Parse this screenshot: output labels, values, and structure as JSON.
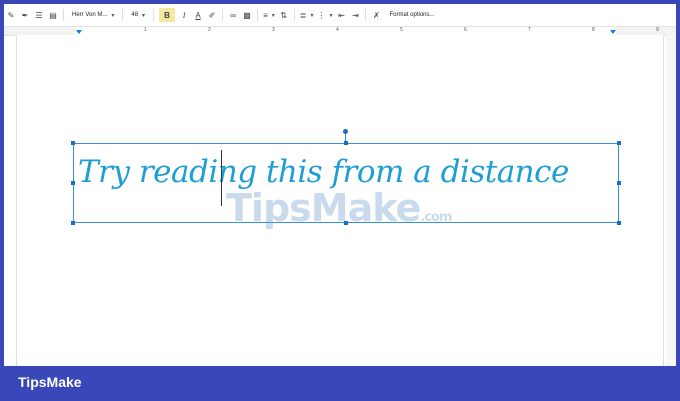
{
  "toolbar": {
    "font_name": "Herr Von M...",
    "font_size": "48",
    "bold": "B",
    "italic": "I",
    "text_color": "A",
    "format_options": "Format options..."
  },
  "ruler": {
    "numbers": [
      "1",
      "2",
      "3",
      "4",
      "5",
      "6",
      "7",
      "8",
      "9"
    ]
  },
  "document": {
    "text": "Try reading this from a distance",
    "text_color": "#1e9fd4"
  },
  "watermark": {
    "main": "TipsMake",
    "suffix": ".com"
  },
  "footer": {
    "brand": "TipsMake",
    "bg_color": "#3a47b8"
  }
}
